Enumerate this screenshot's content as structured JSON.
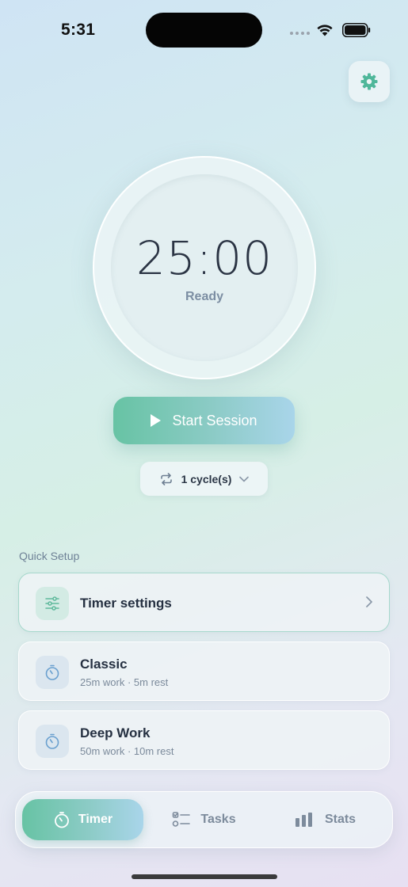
{
  "status_bar": {
    "time": "5:31"
  },
  "timer": {
    "display": "25:00",
    "status": "Ready"
  },
  "actions": {
    "start_label": "Start Session",
    "cycle_label": "1 cycle(s)"
  },
  "quick_setup": {
    "heading": "Quick Setup",
    "items": [
      {
        "title": "Timer settings",
        "icon": "sliders-icon"
      },
      {
        "title": "Classic",
        "subtitle": "25m work · 5m rest",
        "icon": "stopwatch-icon"
      },
      {
        "title": "Deep Work",
        "subtitle": "50m work · 10m rest",
        "icon": "stopwatch-icon"
      }
    ]
  },
  "tabs": [
    {
      "label": "Timer",
      "icon": "stopwatch-icon",
      "active": true
    },
    {
      "label": "Tasks",
      "icon": "checklist-icon",
      "active": false
    },
    {
      "label": "Stats",
      "icon": "bar-chart-icon",
      "active": false
    }
  ],
  "colors": {
    "accent_green": "#67c3a4",
    "accent_blue": "#a9d5ea",
    "text_dark": "#253041",
    "text_muted": "#7b8a9b"
  }
}
